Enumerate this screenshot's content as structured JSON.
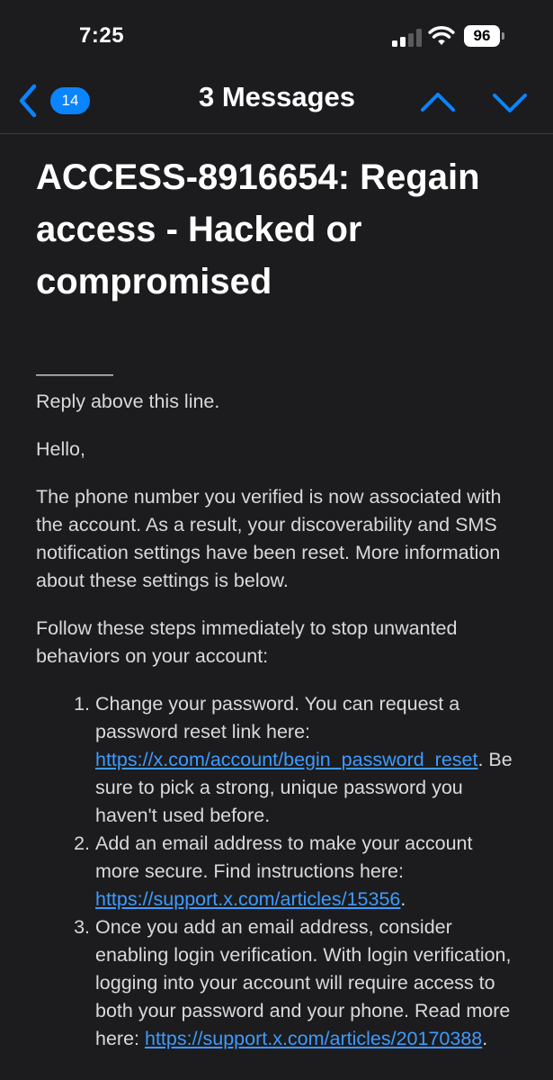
{
  "status_bar": {
    "time": "7:25",
    "battery": "96",
    "icons": [
      "cellular-signal-icon",
      "wifi-icon",
      "battery-icon"
    ]
  },
  "nav": {
    "back_badge": "14",
    "title": "3 Messages",
    "icons": [
      "back-chevron-icon",
      "previous-message-icon",
      "next-message-icon"
    ]
  },
  "colors": {
    "background": "#1c1c1e",
    "accent": "#0a84ff",
    "link": "#3e9bff",
    "text": "#d9d9dd"
  },
  "email": {
    "subject": "ACCESS-8916654: Regain access - Hacked or compromised",
    "separator": "————",
    "reply_line": "Reply above this line.",
    "greeting": "Hello,",
    "paragraph_1": "The phone number you verified is now associated with the account. As a result, your discoverability and SMS notification settings have been reset. More information about these settings is below.",
    "paragraph_2": "Follow these steps immediately to stop unwanted behaviors on your account:",
    "steps": [
      {
        "before": "Change your password. You can request a password reset link here: ",
        "link": "https://x.com/account/begin_password_reset",
        "after": ". Be sure to pick a strong, unique password you haven't used before."
      },
      {
        "before": "Add an email address to make your account more secure. Find instructions here: ",
        "link": "https://support.x.com/articles/15356",
        "after": "."
      },
      {
        "before": "Once you add an email address, consider enabling login verification. With login verification, logging into your account will require access to both your password and your phone. Read more here: ",
        "link": "https://support.x.com/articles/20170388",
        "after": "."
      }
    ]
  }
}
